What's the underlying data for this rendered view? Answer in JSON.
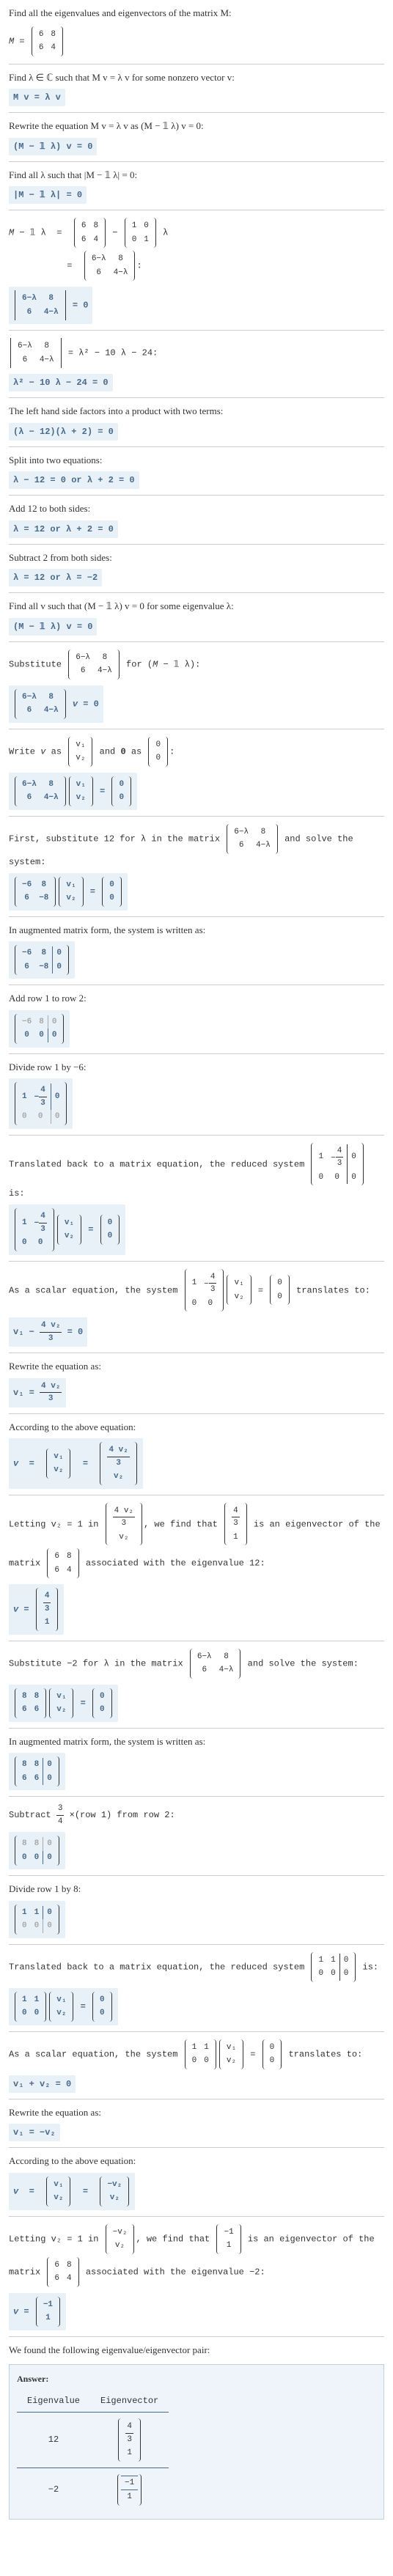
{
  "s1": "Find all the eigenvalues and eigenvectors of the matrix M:",
  "s1m": "M = (6 8; 6 4)",
  "s2": "Find λ ∈ ℂ such that M v = λ v for some nonzero vector v:",
  "r2": "M v = λ v",
  "s3": "Rewrite the equation M v = λ v as (M − 𝟙 λ) v = 0:",
  "r3": "(M − 𝟙 λ) v = 0",
  "s4": "Find all λ such that |M − 𝟙 λ| = 0:",
  "r4": "|M − 𝟙 λ| = 0",
  "s5a": "M − 𝟙 λ  =  (6 8; 6 4) − (1 0; 0 1) λ",
  "s5b": "         =  (6−λ  8;  6  4−λ):",
  "r5": "|6−λ  8;  6  4−λ| = 0",
  "s6": "|6−λ  8;  6  4−λ| = λ² − 10 λ − 24:",
  "r6": "λ² − 10 λ − 24 = 0",
  "s7": "The left hand side factors into a product with two terms:",
  "r7": "(λ − 12)(λ + 2) = 0",
  "s8": "Split into two equations:",
  "r8": "λ − 12 = 0  or  λ + 2 = 0",
  "s9": "Add 12 to both sides:",
  "r9": "λ = 12  or  λ + 2 = 0",
  "s10": "Subtract 2 from both sides:",
  "r10": "λ = 12  or  λ = −2",
  "s11": "Find all v such that (M − 𝟙 λ) v = 0 for some eigenvalue λ:",
  "r11": "(M − 𝟙 λ) v = 0",
  "s12": "Substitute (6−λ  8;  6  4−λ) for (M − 𝟙 λ):",
  "r12": "(6−λ  8;  6  4−λ) v = 0",
  "s13": "Write v as (v₁; v₂) and 0 as (0; 0):",
  "r13": "(6−λ  8;  6  4−λ)(v₁; v₂) = (0; 0)",
  "s14": "First, substitute 12 for λ in the matrix (6−λ  8;  6  4−λ) and solve the system:",
  "r14": "(−6  8;  6  −8)(v₁; v₂) = (0; 0)",
  "s15": "In augmented matrix form, the system is written as:",
  "r15": "(−6  8 | 0;  6  −8 | 0)",
  "s16": "Add row 1 to row 2:",
  "r16": "(−6  8 | 0;  0  0 | 0)",
  "s17": "Divide row 1 by −6:",
  "r17": "(1  −4/3 | 0;  0  0 | 0)",
  "s18": "Translated back to a matrix equation, the reduced system (1  −4/3 | 0; 0  0 | 0) is:",
  "r18": "(1  −4/3;  0  0)(v₁; v₂) = (0; 0)",
  "s19": "As a scalar equation, the system (1  −4/3; 0  0)(v₁;v₂) = (0;0) translates to:",
  "r19": "v₁ − (4 v₂)/3 = 0",
  "s20": "Rewrite the equation as:",
  "r20": "v₁ = (4 v₂)/3",
  "s21": "According to the above equation:",
  "r21": "v  =  (v₁; v₂)  =  ((4v₂)/3; v₂)",
  "s22": "Letting v₂ = 1 in ((4v₂)/3; v₂), we find that (4/3; 1) is an eigenvector of the matrix (6 8; 6 4) associated with the eigenvalue 12:",
  "r22": "v = (4/3; 1)",
  "s23": "Substitute −2 for λ in the matrix (6−λ  8;  6  4−λ) and solve the system:",
  "r23": "(8  8;  6  6)(v₁; v₂) = (0; 0)",
  "s24": "In augmented matrix form, the system is written as:",
  "r24": "(8  8 | 0;  6  6 | 0)",
  "s25": "Subtract 3/4 ×(row 1) from row 2:",
  "r25": "(8  8 | 0;  0  0 | 0)",
  "s26": "Divide row 1 by 8:",
  "r26": "(1  1 | 0;  0  0 | 0)",
  "s27": "Translated back to a matrix equation, the reduced system (1  1 | 0; 0  0 | 0) is:",
  "r27": "(1  1;  0  0)(v₁; v₂) = (0; 0)",
  "s28": "As a scalar equation, the system (1  1; 0  0)(v₁;v₂) = (0;0) translates to:",
  "r28": "v₁ + v₂ = 0",
  "s29": "Rewrite the equation as:",
  "r29": "v₁ = −v₂",
  "s30": "According to the above equation:",
  "r30": "v  =  (v₁; v₂)  =  (−v₂; v₂)",
  "s31": "Letting v₂ = 1 in (−v₂; v₂), we find that (−1; 1) is an eigenvector of the matrix (6 8; 6 4) associated with the eigenvalue −2:",
  "r31": "v = (−1; 1)",
  "s32": "We found the following eigenvalue/eigenvector pair:",
  "answer": {
    "title": "Answer:",
    "headers": [
      "Eigenvalue",
      "Eigenvector"
    ],
    "rows": [
      {
        "val": "12",
        "vec": "(4/3; 1)"
      },
      {
        "val": "−2",
        "vec": "(−1; 1)"
      }
    ]
  },
  "chart_data": {
    "type": "table",
    "title": "Eigenvalue / Eigenvector pairs for M = [[6,8],[6,4]]",
    "columns": [
      "Eigenvalue",
      "Eigenvector"
    ],
    "rows": [
      {
        "Eigenvalue": 12,
        "Eigenvector": [
          1.3333333333,
          1
        ]
      },
      {
        "Eigenvalue": -2,
        "Eigenvector": [
          -1,
          1
        ]
      }
    ]
  }
}
